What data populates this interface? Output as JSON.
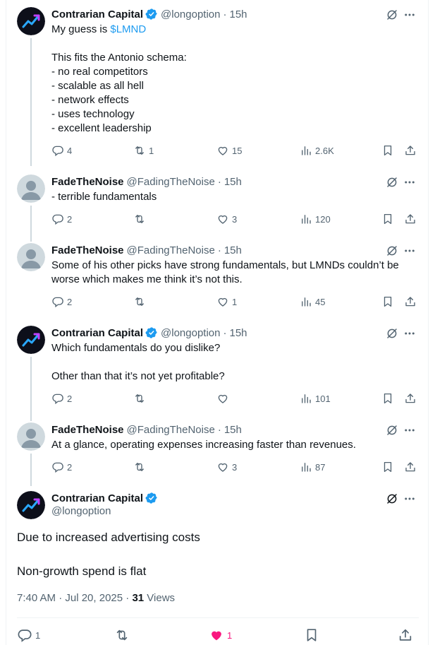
{
  "colors": {
    "accent": "#1d9bf0",
    "like": "#f91880",
    "muted": "#536471",
    "text": "#0f1419"
  },
  "tweets": [
    {
      "name": "Contrarian Capital",
      "handle": "@longoption",
      "dot": "·",
      "time": "15h",
      "text_before": "My guess is ",
      "cashtag": "$LMND",
      "text_after": "\n\nThis fits the Antonio schema:\n- no real competitors\n- scalable as all hell\n- network effects\n- uses technology\n- excellent leadership",
      "replies": "4",
      "retweets": "1",
      "likes": "15",
      "views": "2.6K"
    },
    {
      "name": "FadeTheNoise",
      "handle": "@FadingTheNoise",
      "dot": "·",
      "time": "15h",
      "text": "- terrible fundamentals",
      "replies": "2",
      "retweets": "",
      "likes": "3",
      "views": "120"
    },
    {
      "name": "FadeTheNoise",
      "handle": "@FadingTheNoise",
      "dot": "·",
      "time": "15h",
      "text": "Some of his other picks have strong fundamentals, but LMNDs couldn’t be\nworse which makes me think it’s not this.",
      "replies": "2",
      "retweets": "",
      "likes": "1",
      "views": "45"
    },
    {
      "name": "Contrarian Capital",
      "handle": "@longoption",
      "dot": "·",
      "time": "15h",
      "text": "Which fundamentals do you dislike?\n\nOther than that it’s not yet profitable?",
      "replies": "2",
      "retweets": "",
      "likes": "",
      "views": "101"
    },
    {
      "name": "FadeTheNoise",
      "handle": "@FadingTheNoise",
      "dot": "·",
      "time": "15h",
      "text": "At a glance, operating expenses increasing faster than revenues.",
      "replies": "2",
      "retweets": "",
      "likes": "3",
      "views": "87"
    }
  ],
  "main": {
    "name": "Contrarian Capital",
    "handle": "@longoption",
    "line1": "Due to increased advertising costs",
    "line2": "Non-growth spend is flat",
    "timestamp": "7:40 AM · Jul 20, 2025 · ",
    "views_count": "31",
    "views_label": " Views",
    "replies": "1",
    "retweets": "",
    "likes": "1"
  }
}
